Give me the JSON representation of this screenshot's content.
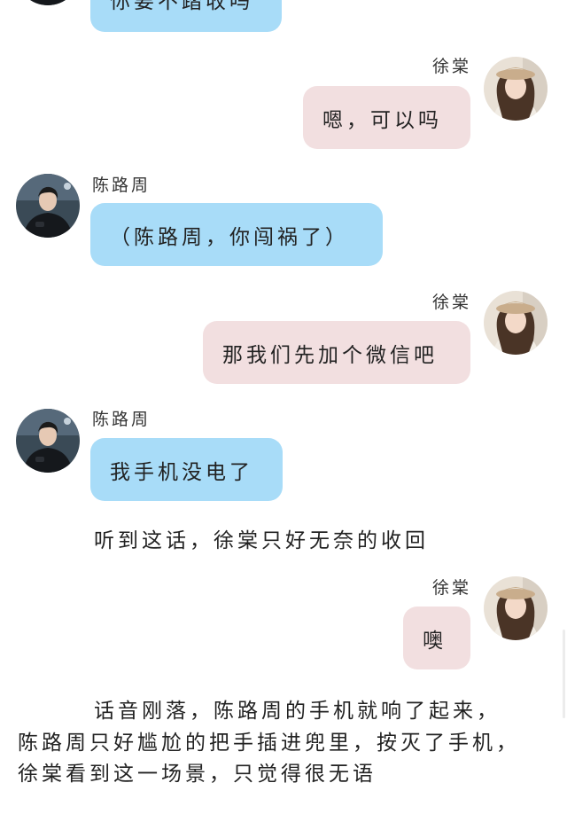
{
  "chat": {
    "top_partial_message": "你要不踏收吗",
    "messages": [
      {
        "speaker": "徐棠",
        "side": "right",
        "text": "嗯，可以吗"
      },
      {
        "speaker": "陈路周",
        "side": "left",
        "text": "（陈路周，你闯祸了）"
      },
      {
        "speaker": "徐棠",
        "side": "right",
        "text": "那我们先加个微信吧"
      },
      {
        "speaker": "陈路周",
        "side": "left",
        "text": "我手机没电了"
      },
      {
        "speaker": "徐棠",
        "side": "right",
        "text": "噢"
      }
    ],
    "narration_1": "听到这话，徐棠只好无奈的收回",
    "narration_2": {
      "line_1": "话音刚落，陈路周的手机就响了起来，",
      "line_2": "陈路周只好尴尬的把手插进兜里，按灭了手机，",
      "line_3": "徐棠看到这一场景，只觉得很无语"
    }
  },
  "colors": {
    "left_bubble": "#a8dcf8",
    "right_bubble": "#f2dfe0",
    "text": "#222222"
  },
  "icons": {
    "male_avatar": "avatar-chen-lu-zhou",
    "female_avatar": "avatar-xu-tang"
  }
}
